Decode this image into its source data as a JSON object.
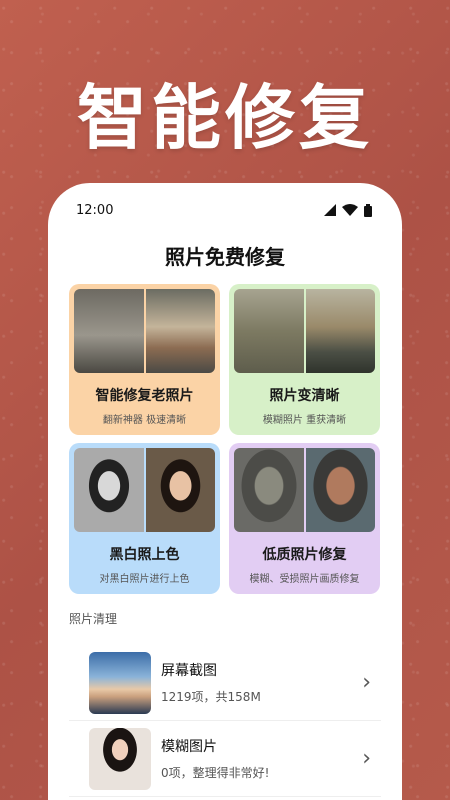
{
  "hero_title": "智能修复",
  "status_bar": {
    "time": "12:00"
  },
  "page_title": "照片免费修复",
  "cards": [
    {
      "title": "智能修复老照片",
      "subtitle": "翻新神器 极速清晰",
      "color": "#fbd3a6"
    },
    {
      "title": "照片变清晰",
      "subtitle": "模糊照片 重获清晰",
      "color": "#d7f0c8"
    },
    {
      "title": "黑白照上色",
      "subtitle": "对黑白照片进行上色",
      "color": "#b9dcfa"
    },
    {
      "title": "低质照片修复",
      "subtitle": "模糊、受损照片画质修复",
      "color": "#e2cdf3"
    }
  ],
  "section_label": "照片清理",
  "list": [
    {
      "title": "屏幕截图",
      "subtitle": "1219项，共158M"
    },
    {
      "title": "模糊图片",
      "subtitle": "0项，整理得非常好!"
    }
  ],
  "icons": [
    "signal-icon",
    "wifi-icon",
    "battery-icon",
    "chevron-right-icon"
  ]
}
